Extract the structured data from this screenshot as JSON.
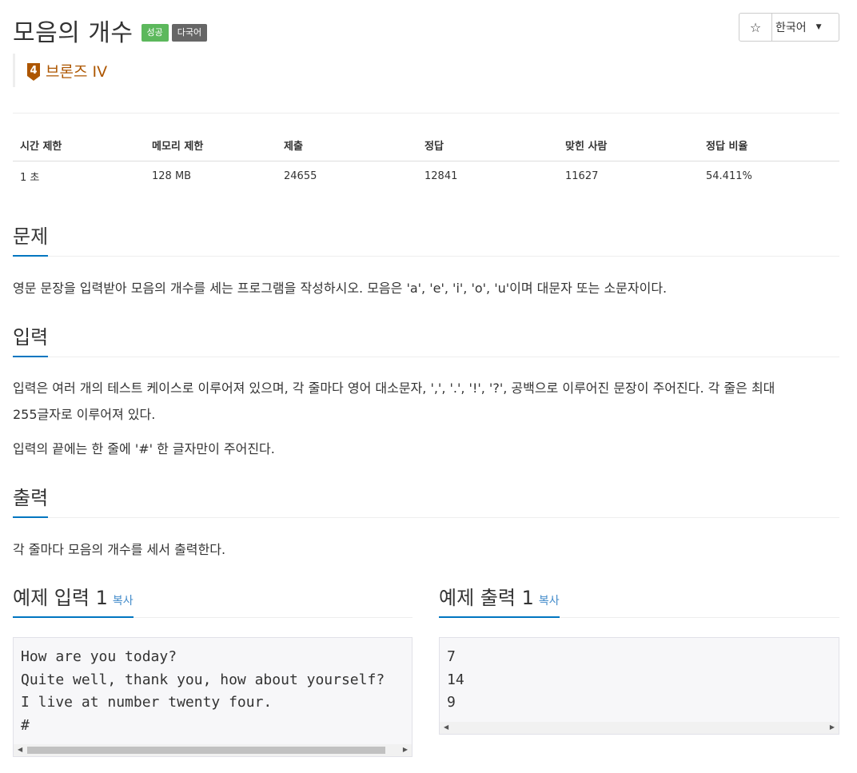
{
  "problem": {
    "title": "모음의 개수",
    "labels": [
      "성공",
      "다국어"
    ],
    "tier": "브론즈 IV",
    "tier_level": "4"
  },
  "actions": {
    "star": "☆",
    "language": "한국어"
  },
  "info_table": {
    "headers": [
      "시간 제한",
      "메모리 제한",
      "제출",
      "정답",
      "맞힌 사람",
      "정답 비율"
    ],
    "values": [
      "1 초",
      "128 MB",
      "24655",
      "12841",
      "11627",
      "54.411%"
    ]
  },
  "sections": {
    "description": {
      "heading": "문제",
      "text": "영문 문장을 입력받아 모음의 개수를 세는 프로그램을 작성하시오. 모음은 'a', 'e', 'i', 'o', 'u'이며 대문자 또는 소문자이다."
    },
    "input": {
      "heading": "입력",
      "line1": "입력은 여러 개의 테스트 케이스로 이루어져 있으며, 각 줄마다 영어 대소문자, ',', '.', '!', '?', 공백으로 이루어진 문장이 주어진다. 각 줄은 최대",
      "line2": "255글자로 이루어져 있다.",
      "line3": "입력의 끝에는 한 줄에 '#' 한 글자만이 주어진다."
    },
    "output": {
      "heading": "출력",
      "text": "각 줄마다 모음의 개수를 세서 출력한다."
    }
  },
  "samples": {
    "input": {
      "heading": "예제 입력 1",
      "copy": "복사",
      "content": "How are you today?\nQuite well, thank you, how about yourself?\nI live at number twenty four.\n#"
    },
    "output": {
      "heading": "예제 출력 1",
      "copy": "복사",
      "content": "7\n14\n9"
    }
  },
  "colors": {
    "success": "#5cb85c",
    "default_label": "#666666",
    "bronze": "#ad5600",
    "accent": "#0076c0",
    "link": "#428bca"
  }
}
